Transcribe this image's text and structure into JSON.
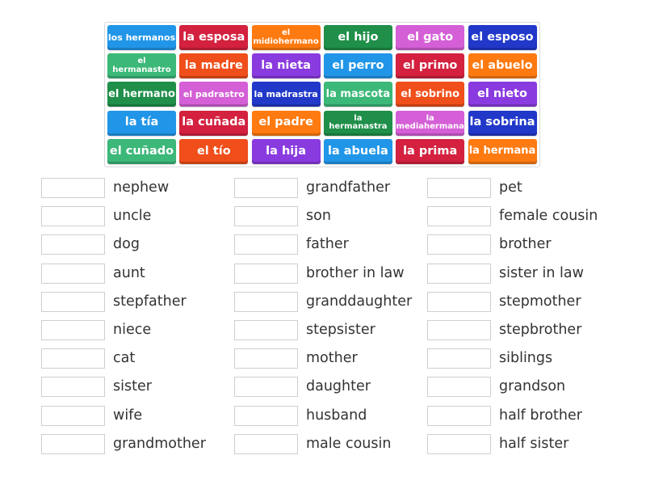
{
  "colors": {
    "blue": "#2196e8",
    "red": "#d3213f",
    "orange": "#ff7a10",
    "green": "#3cb878",
    "vermilion": "#f04e1a",
    "purple": "#8a3be0",
    "darkgreen": "#1f8f4a",
    "magenta": "#d45fd6",
    "navy": "#2138c9"
  },
  "tiles": [
    {
      "text": "los hermanos",
      "color": "#2196e8",
      "size": "s11"
    },
    {
      "text": "la esposa",
      "color": "#d3213f",
      "size": "s15"
    },
    {
      "text": "el midiohermano",
      "color": "#ff7a10",
      "size": "two"
    },
    {
      "text": "el hijo",
      "color": "#1f8f4a",
      "size": "s15"
    },
    {
      "text": "el gato",
      "color": "#d45fd6",
      "size": "s15"
    },
    {
      "text": "el esposo",
      "color": "#2138c9",
      "size": "s15"
    },
    {
      "text": "el hermanastro",
      "color": "#3cb878",
      "size": "two"
    },
    {
      "text": "la madre",
      "color": "#f04e1a",
      "size": "s15"
    },
    {
      "text": "la nieta",
      "color": "#8a3be0",
      "size": "s15"
    },
    {
      "text": "el perro",
      "color": "#2196e8",
      "size": "s15"
    },
    {
      "text": "el primo",
      "color": "#d3213f",
      "size": "s15"
    },
    {
      "text": "el abuelo",
      "color": "#ff7a10",
      "size": "s15"
    },
    {
      "text": "el hermano",
      "color": "#1f8f4a",
      "size": "s13"
    },
    {
      "text": "el padrastro",
      "color": "#d45fd6",
      "size": "s11"
    },
    {
      "text": "la madrastra",
      "color": "#2138c9",
      "size": "s11"
    },
    {
      "text": "la mascota",
      "color": "#3cb878",
      "size": "s13"
    },
    {
      "text": "el sobrino",
      "color": "#f04e1a",
      "size": "s13"
    },
    {
      "text": "el nieto",
      "color": "#8a3be0",
      "size": "s15"
    },
    {
      "text": "la tía",
      "color": "#2196e8",
      "size": "s15"
    },
    {
      "text": "la cuñada",
      "color": "#d3213f",
      "size": "s15"
    },
    {
      "text": "el padre",
      "color": "#ff7a10",
      "size": "s15"
    },
    {
      "text": "la hermanastra",
      "color": "#1f8f4a",
      "size": "two"
    },
    {
      "text": "la mediahermana",
      "color": "#d45fd6",
      "size": "two"
    },
    {
      "text": "la sobrina",
      "color": "#2138c9",
      "size": "s15"
    },
    {
      "text": "el cuñado",
      "color": "#3cb878",
      "size": "s15"
    },
    {
      "text": "el tío",
      "color": "#f04e1a",
      "size": "s15"
    },
    {
      "text": "la hija",
      "color": "#8a3be0",
      "size": "s15"
    },
    {
      "text": "la abuela",
      "color": "#2196e8",
      "size": "s15"
    },
    {
      "text": "la prima",
      "color": "#d3213f",
      "size": "s15"
    },
    {
      "text": "la hermana",
      "color": "#ff7a10",
      "size": "s13"
    }
  ],
  "targets": [
    [
      "nephew",
      "uncle",
      "dog",
      "aunt",
      "stepfather",
      "niece",
      "cat",
      "sister",
      "wife",
      "grandmother"
    ],
    [
      "grandfather",
      "son",
      "father",
      "brother in law",
      "granddaughter",
      "stepsister",
      "mother",
      "daughter",
      "husband",
      "male cousin"
    ],
    [
      "pet",
      "female cousin",
      "brother",
      "sister in law",
      "stepmother",
      "stepbrother",
      "siblings",
      "grandson",
      "half brother",
      "half sister"
    ]
  ]
}
